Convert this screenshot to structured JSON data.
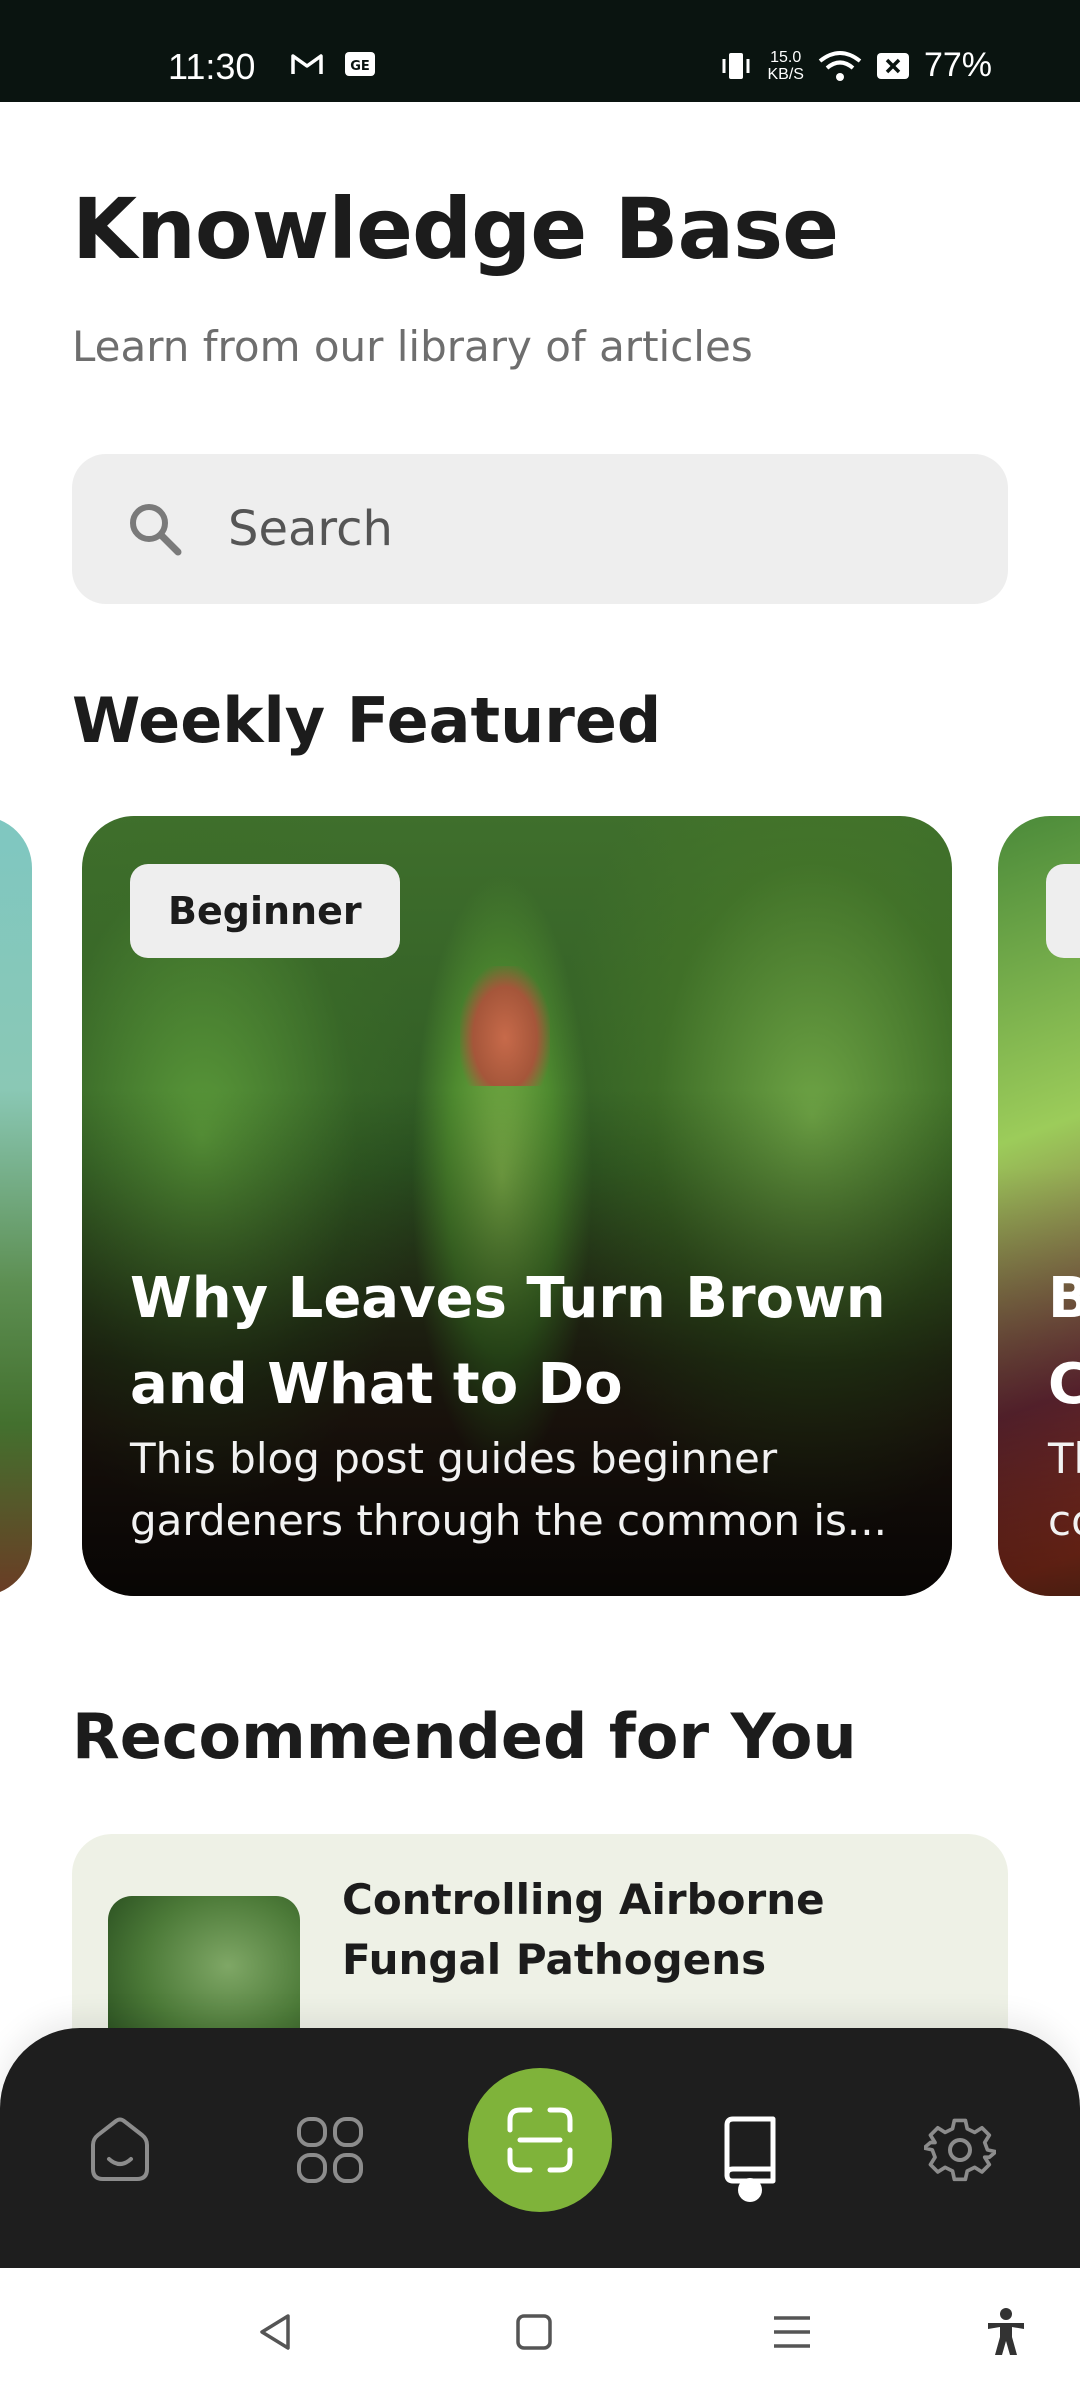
{
  "status_bar": {
    "time": "11:30",
    "left_icons": [
      "gmail-icon",
      "sim-card-icon"
    ],
    "net_speed_value": "15.0",
    "net_speed_unit": "KB/S",
    "right_icons": [
      "vibrate-icon",
      "wifi-icon",
      "no-sim-icon"
    ],
    "battery": "77%"
  },
  "header": {
    "title": "Knowledge Base",
    "subtitle": "Learn from our library of articles"
  },
  "search": {
    "placeholder": "Search",
    "icon": "search-icon"
  },
  "weekly_featured": {
    "title": "Weekly Featured",
    "cards": [
      {
        "badge": "Beginner",
        "title": "Why Leaves Turn Brown and What to Do",
        "description": "This blog post guides beginner gardeners through the common is..."
      },
      {
        "title_fragment": "B",
        "title_fragment_2": "C",
        "desc_fragment": "Th",
        "desc_fragment_2": "co"
      }
    ]
  },
  "recommended": {
    "title": "Recommended for You",
    "items": [
      {
        "title": "Controlling Airborne Fungal Pathogens"
      }
    ]
  },
  "bottom_nav": {
    "items": [
      "home-icon",
      "apps-icon",
      "scan-icon",
      "library-icon",
      "settings-icon"
    ],
    "active": "library-icon",
    "accent": "#7fb33a",
    "background": "#1e1e1e"
  },
  "system_nav": {
    "items": [
      "back-icon",
      "home-square-icon",
      "recents-icon",
      "accessibility-icon"
    ]
  }
}
